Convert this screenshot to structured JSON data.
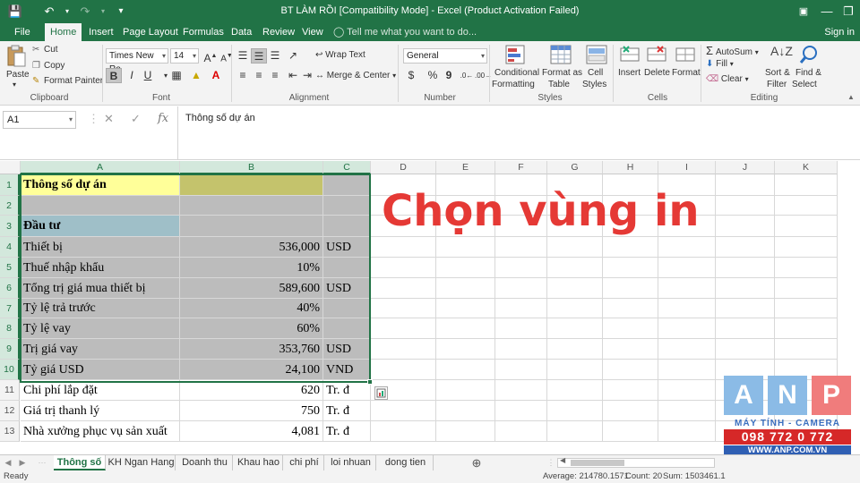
{
  "window": {
    "title": "BT LÀM RỒI  [Compatibility Mode] - Excel (Product Activation Failed)"
  },
  "ribbon_tabs": [
    "File",
    "Home",
    "Insert",
    "Page Layout",
    "Formulas",
    "Data",
    "Review",
    "View"
  ],
  "active_tab": "Home",
  "tell_me": "Tell me what you want to do...",
  "sign_in": "Sign in",
  "clipboard": {
    "paste": "Paste",
    "cut": "Cut",
    "copy": "Copy",
    "format_painter": "Format Painter",
    "label": "Clipboard"
  },
  "font": {
    "name": "Times New Ro",
    "size": "14",
    "bold": "B",
    "italic": "I",
    "underline": "U",
    "label": "Font"
  },
  "alignment": {
    "wrap_text": "Wrap Text",
    "merge_center": "Merge & Center",
    "label": "Alignment"
  },
  "number": {
    "format": "General",
    "currency": "$",
    "percent": "%",
    "comma": "9",
    "label": "Number"
  },
  "styles": {
    "conditional": [
      "Conditional",
      "Formatting"
    ],
    "format_table": [
      "Format as",
      "Table"
    ],
    "cell_styles": [
      "Cell",
      "Styles"
    ],
    "label": "Styles"
  },
  "cells": {
    "insert": "Insert",
    "delete": "Delete",
    "format": "Format",
    "label": "Cells"
  },
  "editing": {
    "autosum": "AutoSum",
    "fill": "Fill",
    "clear": "Clear",
    "sort_filter": [
      "Sort &",
      "Filter"
    ],
    "find_select": [
      "Find &",
      "Select"
    ],
    "label": "Editing"
  },
  "formula_bar": {
    "name_box": "A1",
    "fx": "fx",
    "content": "Thông số dự án"
  },
  "columns": [
    "A",
    "B",
    "C",
    "D",
    "E",
    "F",
    "G",
    "H",
    "I",
    "J",
    "K"
  ],
  "rows": [
    {
      "num": "1",
      "a": "Thông số dự án",
      "b": "",
      "c": ""
    },
    {
      "num": "2",
      "a": "",
      "b": "",
      "c": ""
    },
    {
      "num": "3",
      "a": "Đầu tư",
      "b": "",
      "c": ""
    },
    {
      "num": "4",
      "a": "Thiết bị",
      "b": "536,000",
      "c": "USD"
    },
    {
      "num": "5",
      "a": "Thuế nhập khẩu",
      "b": "10%",
      "c": ""
    },
    {
      "num": "6",
      "a": "Tổng trị giá mua thiết bị",
      "b": "589,600",
      "c": "USD"
    },
    {
      "num": "7",
      "a": "Tỷ lệ trả trước",
      "b": "40%",
      "c": ""
    },
    {
      "num": "8",
      "a": "Tỷ lệ vay",
      "b": "60%",
      "c": ""
    },
    {
      "num": "9",
      "a": "Trị giá vay",
      "b": "353,760",
      "c": "USD"
    },
    {
      "num": "10",
      "a": "Tỷ giá USD",
      "b": "24,100",
      "c": "VND"
    },
    {
      "num": "11",
      "a": "Chi phí lắp đặt",
      "b": "620",
      "c": "Tr. đ"
    },
    {
      "num": "12",
      "a": "Giá trị thanh lý",
      "b": "750",
      "c": "Tr. đ"
    },
    {
      "num": "13",
      "a": "Nhà xưởng phục vụ sản xuất",
      "b": "4,081",
      "c": "Tr. đ"
    }
  ],
  "overlay_text": "Chọn vùng in",
  "sheet_tabs": [
    "Thông số",
    "KH Ngan Hang",
    "Doanh thu",
    "Khau hao",
    "chi phí",
    "loi nhuan",
    "dong tien"
  ],
  "active_sheet": "Thông số",
  "status": {
    "ready": "Ready",
    "average": "Average: 214780.1571",
    "count": "Count: 20",
    "sum": "Sum: 1503461.1"
  },
  "watermark": {
    "letters": [
      "A",
      "N",
      "P"
    ],
    "tagline": "MÁY TÍNH - CAMERA",
    "phone": "098 772 0 772",
    "website": "WWW.ANP.COM.VN"
  },
  "colors": {
    "excel_green": "#217346",
    "overlay_red": "#e53935",
    "row1_fill": "#ffff99",
    "row3_fill": "#b7dde8",
    "selection_shade": "#bcbcbc"
  }
}
